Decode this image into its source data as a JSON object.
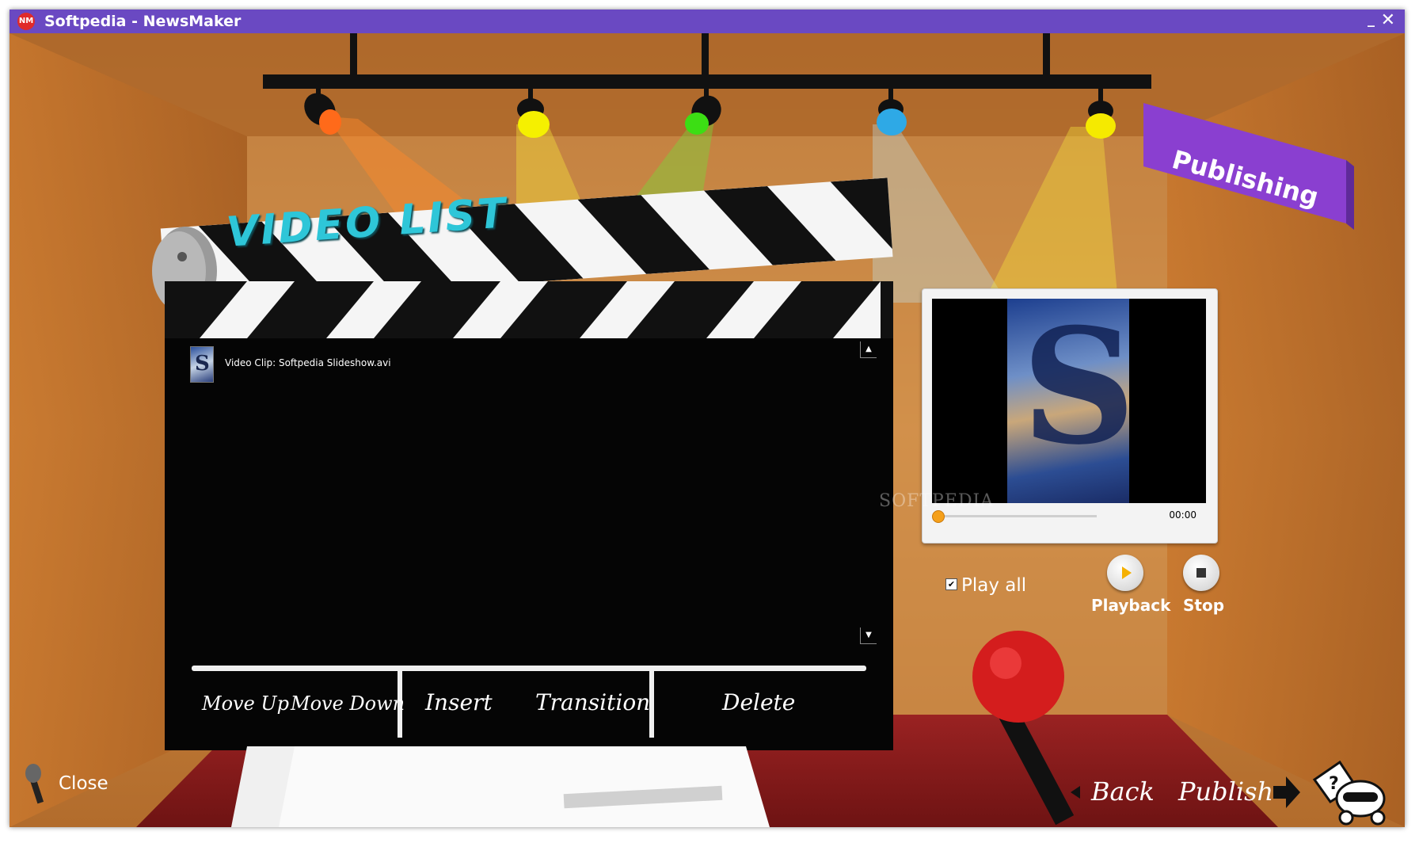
{
  "window": {
    "title": "Softpedia - NewsMaker",
    "icon": "newsmaker-app-icon",
    "minimize_label": "_",
    "close_label": "✕"
  },
  "header": {
    "video_list_title": "VIDEO LIST",
    "publishing_banner": "Publishing"
  },
  "video_list": {
    "items": [
      {
        "label": "Video Clip: Softpedia Slideshow.avi",
        "thumb_icon": "softpedia-s-thumbnail"
      }
    ],
    "scroll_up": "▲",
    "scroll_down": "▼"
  },
  "commands": {
    "move_up": "Move Up",
    "move_down": "Move Down",
    "insert": "Insert",
    "transition": "Transition",
    "delete": "Delete"
  },
  "preview": {
    "time": "00:00",
    "progress": 0,
    "play_all_label": "Play all",
    "play_all_checked": true,
    "playback_label": "Playback",
    "stop_label": "Stop"
  },
  "footer": {
    "close_label": "Close",
    "back_label": "Back",
    "publish_label": "Publish"
  },
  "watermark": "SOFTPEDIA",
  "colors": {
    "titlebar": "#6a49c2",
    "publishing_banner": "#8a3fd0",
    "video_list_title": "#2ec6d8",
    "stage_wall": "#c9823c",
    "red_carpet": "#8a1c1c"
  }
}
